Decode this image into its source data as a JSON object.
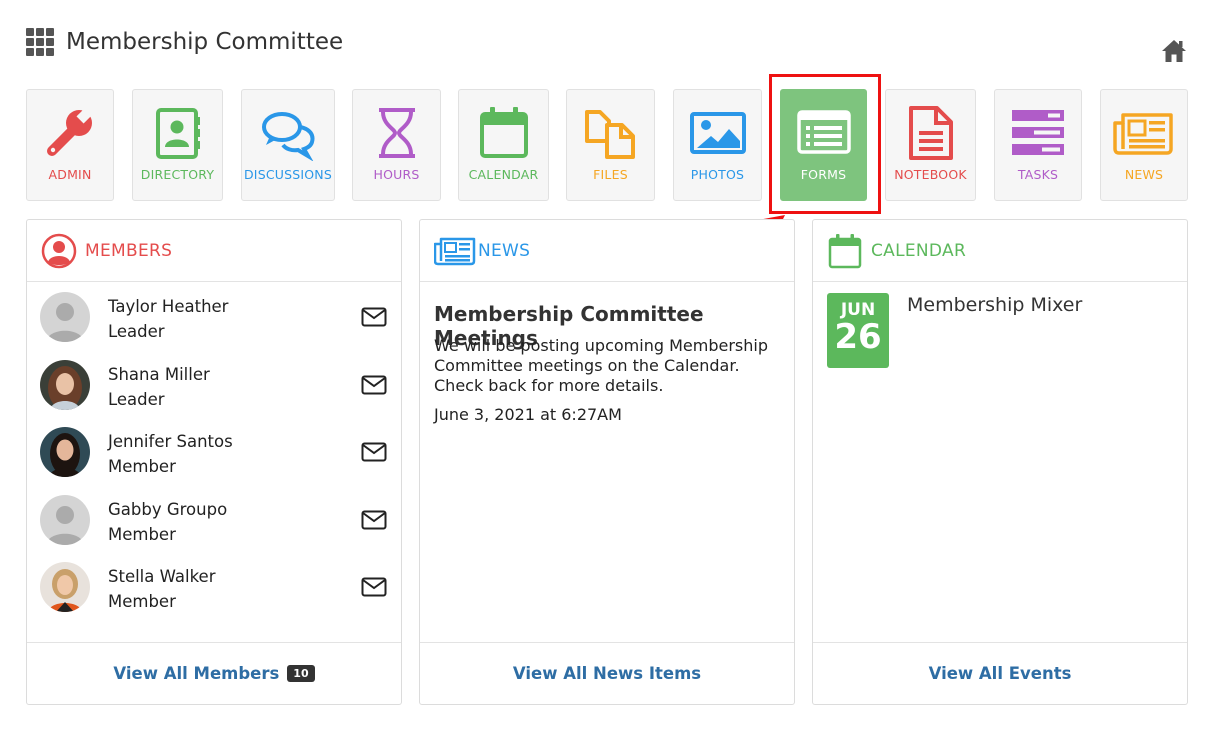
{
  "header": {
    "title": "Membership Committee"
  },
  "tiles": [
    {
      "label": "ADMIN",
      "icon": "wrench-icon",
      "color": "#e44c4c"
    },
    {
      "label": "DIRECTORY",
      "icon": "contact-book-icon",
      "color": "#5cb85c"
    },
    {
      "label": "DISCUSSIONS",
      "icon": "chat-bubbles-icon",
      "color": "#2a97e8"
    },
    {
      "label": "HOURS",
      "icon": "hourglass-icon",
      "color": "#b05cc8"
    },
    {
      "label": "CALENDAR",
      "icon": "calendar-icon",
      "color": "#5cb85c"
    },
    {
      "label": "FILES",
      "icon": "files-icon",
      "color": "#f5a623"
    },
    {
      "label": "PHOTOS",
      "icon": "image-icon",
      "color": "#2a97e8"
    },
    {
      "label": "FORMS",
      "icon": "form-icon",
      "color": "#ffffff"
    },
    {
      "label": "NOTEBOOK",
      "icon": "document-icon",
      "color": "#e44c4c"
    },
    {
      "label": "TASKS",
      "icon": "tasks-icon",
      "color": "#b05cc8"
    },
    {
      "label": "NEWS",
      "icon": "newspaper-icon",
      "color": "#f5a623"
    }
  ],
  "members_panel": {
    "title": "MEMBERS",
    "members": [
      {
        "name": "Taylor Heather",
        "role": "Leader"
      },
      {
        "name": "Shana Miller",
        "role": "Leader"
      },
      {
        "name": "Jennifer Santos",
        "role": "Member"
      },
      {
        "name": "Gabby Groupo",
        "role": "Member"
      },
      {
        "name": "Stella Walker",
        "role": "Member"
      }
    ],
    "footer_link": "View All Members",
    "count": "10"
  },
  "news_panel": {
    "title": "NEWS",
    "item_title": "Membership Committee Meetings",
    "item_body": "We will be posting upcoming Membership Committee meetings on the Calendar. Check back for more details.",
    "item_date": "June 3, 2021 at 6:27AM",
    "footer_link": "View All News Items"
  },
  "calendar_panel": {
    "title": "CALENDAR",
    "event_month": "JUN",
    "event_day": "26",
    "event_title": "Membership Mixer",
    "footer_link": "View All Events"
  },
  "colors": {
    "red": "#e44c4c",
    "green": "#5cb85c",
    "blue": "#2a97e8",
    "purple": "#b05cc8",
    "orange": "#f5a623",
    "active_tile": "#7ec47e",
    "link": "#2e6da4",
    "highlight": "#ee1111"
  }
}
